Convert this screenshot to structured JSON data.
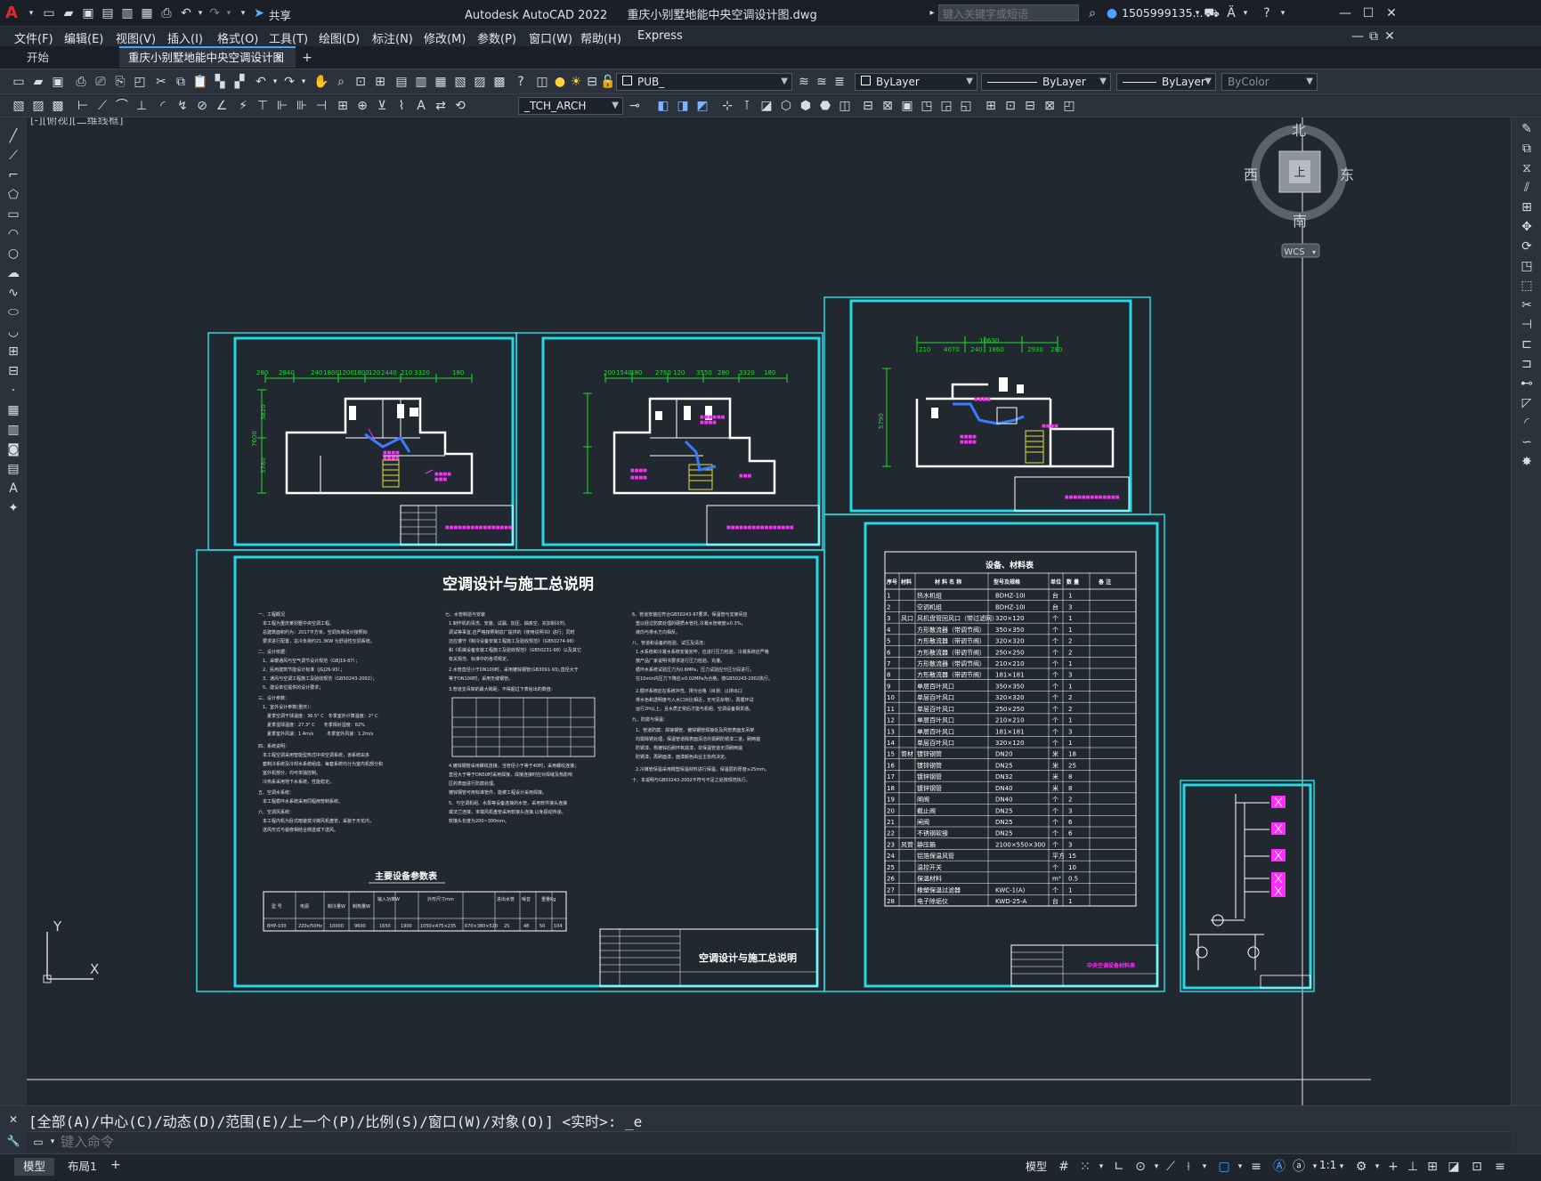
{
  "window": {
    "title_app": "Autodesk AutoCAD 2022",
    "title_file": "重庆小别墅地能中央空调设计图.dwg",
    "share_label": "共享",
    "search_placeholder": "键入关键字或短语",
    "user": "1505999135...",
    "app_logo": "A"
  },
  "menu": [
    "文件(F)",
    "编辑(E)",
    "视图(V)",
    "插入(I)",
    "格式(O)",
    "工具(T)",
    "绘图(D)",
    "标注(N)",
    "修改(M)",
    "参数(P)",
    "窗口(W)",
    "帮助(H)",
    "Express"
  ],
  "tabs": {
    "start": "开始",
    "active": "重庆小别墅地能中央空调设计图*",
    "add": "+"
  },
  "toolbar": {
    "layer_value": "PUB_",
    "color_value": "ByLayer",
    "linetype_value": "ByLayer",
    "lineweight_value": "ByLayer",
    "plotstyle_value": "ByColor",
    "textstyle_value": "_TCH_ARCH"
  },
  "viewport": {
    "label": "[-][俯视][二维线框]",
    "viewcube": {
      "north": "北",
      "south": "南",
      "east": "东",
      "west": "西",
      "top": "上",
      "wcs": "WCS"
    },
    "ucs": {
      "x": "X",
      "y": "Y"
    }
  },
  "drawing": {
    "sheet_spec_title": "空调设计与施工总说明",
    "spec_titleblock_name": "空调设计与施工总说明",
    "equip_param_title": "主要设备参数表",
    "equip_param_headers": [
      "型 号",
      "电源",
      "制冷量W",
      "制热量W",
      "输入功率W",
      "外形尺寸mm",
      "进出水管",
      "噪音",
      "重量Kg"
    ],
    "equip_param_row": [
      "BHP-100",
      "220v/50Hz",
      "10000",
      "9600",
      "1650",
      "1900",
      "1050×475×235",
      "670×380×520",
      "25",
      "48",
      "50",
      "104"
    ],
    "material_table_title": "设备、材料表",
    "material_headers": [
      "序号",
      "材料",
      "材 料 名 称",
      "型号及规格",
      "单位",
      "数 量",
      "备 注"
    ],
    "material_rows": [
      [
        "1",
        "",
        "热水机组",
        "BDHZ-10I",
        "台",
        "1"
      ],
      [
        "2",
        "",
        "空调机组",
        "BDHZ-10I",
        "台",
        "3"
      ],
      [
        "3",
        "风口",
        "风机盘管回风口（带过滤网）",
        "320×120",
        "个",
        "1"
      ],
      [
        "4",
        "",
        "方形散流器（带调节阀）",
        "350×350",
        "个",
        "1"
      ],
      [
        "5",
        "",
        "方形散流器（带调节阀）",
        "320×320",
        "个",
        "2"
      ],
      [
        "6",
        "",
        "方形散流器（带调节阀）",
        "250×250",
        "个",
        "2"
      ],
      [
        "7",
        "",
        "方形散流器（带调节阀）",
        "210×210",
        "个",
        "1"
      ],
      [
        "8",
        "",
        "方形散流器（带调节阀）",
        "181×181",
        "个",
        "3"
      ],
      [
        "9",
        "",
        "单层百叶风口",
        "350×350",
        "个",
        "1"
      ],
      [
        "10",
        "",
        "单层百叶风口",
        "320×320",
        "个",
        "2"
      ],
      [
        "11",
        "",
        "单层百叶风口",
        "250×250",
        "个",
        "2"
      ],
      [
        "12",
        "",
        "单层百叶风口",
        "210×210",
        "个",
        "1"
      ],
      [
        "13",
        "",
        "单层百叶风口",
        "181×181",
        "个",
        "3"
      ],
      [
        "14",
        "",
        "单层百叶风口",
        "320×120",
        "个",
        "1"
      ],
      [
        "15",
        "管材",
        "镀锌钢管",
        "DN20",
        "米",
        "18"
      ],
      [
        "16",
        "",
        "镀锌钢管",
        "DN25",
        "米",
        "25"
      ],
      [
        "17",
        "",
        "镀锌钢管",
        "DN32",
        "米",
        "8"
      ],
      [
        "18",
        "",
        "镀锌钢管",
        "DN40",
        "米",
        "8"
      ],
      [
        "19",
        "",
        "闸阀",
        "DN40",
        "个",
        "2"
      ],
      [
        "20",
        "",
        "截止阀",
        "DN25",
        "个",
        "3"
      ],
      [
        "21",
        "",
        "闸阀",
        "DN25",
        "个",
        "6"
      ],
      [
        "22",
        "",
        "不锈钢软接",
        "DN25",
        "个",
        "6"
      ],
      [
        "23",
        "风管",
        "静压箱",
        "2100×550×300",
        "个",
        "3"
      ],
      [
        "24",
        "",
        "铝箔保温风管",
        "",
        "平方",
        "15"
      ],
      [
        "25",
        "",
        "温控开关",
        "",
        "个",
        "10"
      ],
      [
        "26",
        "",
        "保温材料",
        "",
        "m³",
        "0.5"
      ],
      [
        "27",
        "",
        "橡塑保温过滤器",
        "KWC-1(A)",
        "个",
        "1"
      ],
      [
        "28",
        "",
        "电子除垢仪",
        "KWD-25-A",
        "台",
        "1"
      ]
    ],
    "material_titleblock_name": "中央空调设备材料表",
    "floor1_dims": [
      "280",
      "2840",
      "240",
      "1800",
      "1200",
      "1800",
      "120",
      "2440",
      "210",
      "3320",
      "180"
    ],
    "floor2_dims": [
      "200",
      "1540",
      "480",
      "2760",
      "120",
      "3550",
      "280",
      "3320",
      "180"
    ],
    "floor3_dims": [
      "210",
      "4070",
      "240",
      "1860",
      "2930",
      "280",
      "10630"
    ],
    "floor1_vert": [
      "7600",
      "3780",
      "3820"
    ],
    "floor3_vert": [
      "5790"
    ]
  },
  "command": {
    "history": "[全部(A)/中心(C)/动态(D)/范围(E)/上一个(P)/比例(S)/窗口(W)/对象(O)] <实时>: _e",
    "placeholder": "键入命令"
  },
  "status": {
    "model_tab": "模型",
    "layout_tab": "布局1",
    "add_tab": "+",
    "model_space": "模型",
    "scale": "1:1"
  },
  "colors": {
    "frame": "#22d9e4",
    "wall": "#ffffff",
    "dim": "#1ddc2d",
    "tag": "#ff2bff",
    "duct": "#3a7cff",
    "stair": "#e6e03b",
    "bg": "#212830"
  }
}
